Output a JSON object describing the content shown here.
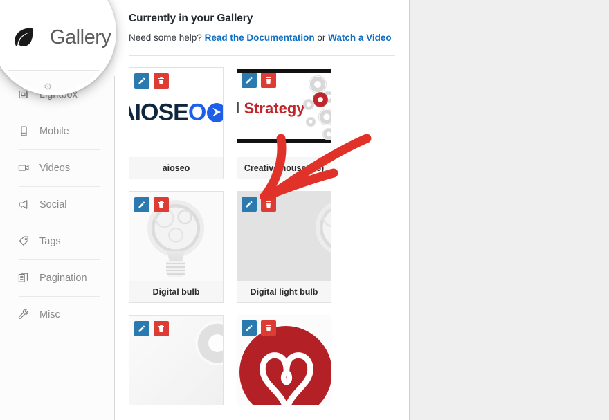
{
  "sidebar": {
    "items": [
      {
        "label": "Lightbox",
        "icon": "lightbox-icon"
      },
      {
        "label": "Mobile",
        "icon": "mobile-icon"
      },
      {
        "label": "Videos",
        "icon": "video-camera-icon"
      },
      {
        "label": "Social",
        "icon": "megaphone-icon"
      },
      {
        "label": "Tags",
        "icon": "tag-icon"
      },
      {
        "label": "Pagination",
        "icon": "pagination-icon"
      },
      {
        "label": "Misc",
        "icon": "wrench-icon"
      }
    ]
  },
  "magnifier": {
    "label": "Gallery",
    "icon": "leaf-icon"
  },
  "main": {
    "title": "Currently in your Gallery",
    "help_prefix": "Need some help? ",
    "help_link_docs": "Read the Documentation",
    "help_separator": " or ",
    "help_link_video": "Watch a Video"
  },
  "actions": {
    "edit_label": "Edit",
    "delete_label": "Delete",
    "edit_icon": "pencil-icon",
    "delete_icon": "trash-icon"
  },
  "gallery": {
    "items": [
      {
        "label": "aioseo",
        "art": "aioseo-logo",
        "logo_text_dark": "AIOSE",
        "logo_text_blue": "O",
        "hovered": false,
        "label_visible": true
      },
      {
        "label": "Creative house (15)",
        "art": "digital-strategy-banner",
        "banner_text_grey": "al ",
        "banner_text_red": "Strategy",
        "hovered": false,
        "label_visible": true
      },
      {
        "label": "Digital bulb",
        "art": "gear-lightbulb",
        "hovered": false,
        "label_visible": true
      },
      {
        "label": "Digital light bulb",
        "art": "gear-lightbulb-cropped",
        "hovered": true,
        "label_visible": true
      },
      {
        "label": "",
        "art": "faint-gear",
        "hovered": false,
        "label_visible": false
      },
      {
        "label": "",
        "art": "red-heart-circle",
        "hovered": false,
        "label_visible": false
      }
    ]
  },
  "annotation": {
    "type": "hand-drawn-arrow",
    "color": "#e03229",
    "points_to": "delete-button-of-digital-light-bulb"
  },
  "colors": {
    "edit_blue": "#2a7ab0",
    "delete_red": "#dd3c34",
    "link_blue": "#0f6fc5",
    "page_bg": "#efefef",
    "panel_bg": "#ffffff",
    "sidebar_bg": "#fcfcfc",
    "annotation_red": "#e03229"
  }
}
